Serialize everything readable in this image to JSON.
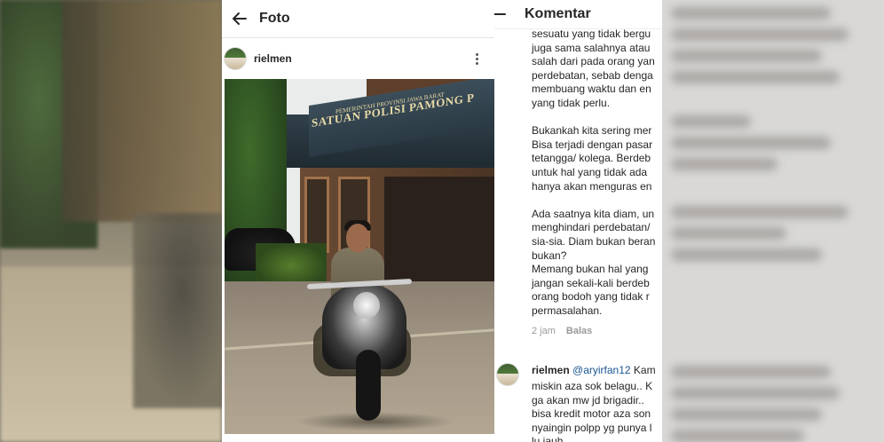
{
  "post_view": {
    "title": "Foto",
    "username": "rielmen",
    "photo_sign": {
      "small_text": "PEMERINTAH PROVINSI JAWA BARAT",
      "main_text": "SATUAN POLISI PAMONG P"
    }
  },
  "comments_view": {
    "title": "Komentar",
    "comment1": {
      "text": "sesuatu yang tidak bergu\njuga sama salahnya atau\nsalah dari pada orang yan\nperdebatan, sebab denga\nmembuang waktu dan en\nyang tidak perlu.\n\nBukankah kita sering mer\nBisa terjadi dengan pasar\ntetangga/ kolega. Berdeb\nuntuk hal yang tidak ada \nhanya akan menguras en\n\nAda saatnya kita diam, un\nmenghindari perdebatan/\nsia-sia. Diam bukan beran\nbukan?\nMemang bukan hal yang \njangan sekali-kali berdeb\norang bodoh yang tidak r\npermasalahan.",
      "time": "2 jam",
      "reply_label": "Balas"
    },
    "comment2": {
      "username": "rielmen",
      "mention": "@aryirfan12",
      "first_line_rest": " Kam",
      "text": "miskin aza sok belagu.. K\nga akan mw jd brigadir.. \nbisa kredit motor aza son\nnyaingin polpp yg punya l\nlu jauh"
    }
  },
  "colors": {
    "text": "#262626",
    "meta": "#999999",
    "mention": "#1a5690"
  },
  "icons": {
    "back": "arrow-left-icon",
    "more": "vertical-ellipsis-icon"
  }
}
